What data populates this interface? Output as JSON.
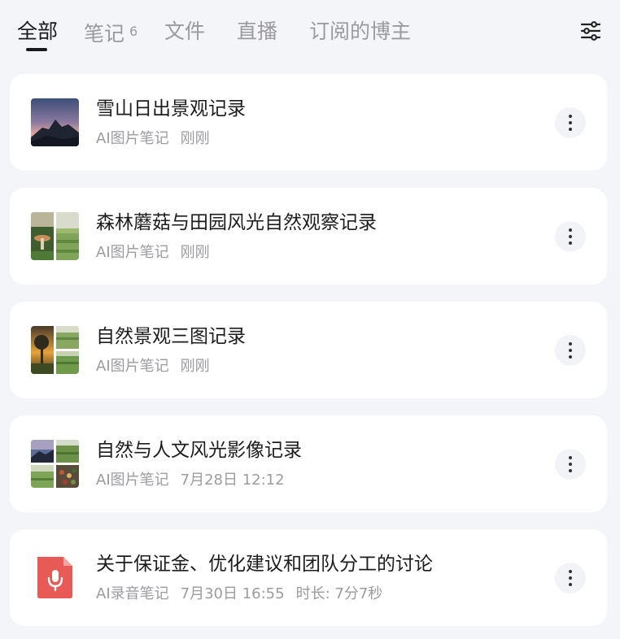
{
  "tabs": [
    {
      "label": "全部",
      "active": true
    },
    {
      "label": "笔记",
      "badge": "6"
    },
    {
      "label": "文件"
    },
    {
      "label": "直播"
    },
    {
      "label": "订阅的博主"
    }
  ],
  "notes": [
    {
      "title": "雪山日出景观记录",
      "type": "AI图片笔记",
      "time": "刚刚",
      "thumb": "mountain-sunrise-photo"
    },
    {
      "title": "森林蘑菇与田园风光自然观察记录",
      "type": "AI图片笔记",
      "time": "刚刚",
      "thumb": "two-photo-collage"
    },
    {
      "title": "自然景观三图记录",
      "type": "AI图片笔记",
      "time": "刚刚",
      "thumb": "three-photo-collage"
    },
    {
      "title": "自然与人文风光影像记录",
      "type": "AI图片笔记",
      "time": "7月28日 12:12",
      "thumb": "four-photo-collage"
    },
    {
      "title": "关于保证金、优化建议和团队分工的讨论",
      "type": "AI录音笔记",
      "time": "7月30日 16:55",
      "duration": "时长: 7分7秒",
      "thumb": "audio-file-icon"
    }
  ],
  "colors": {
    "background": "#f4f5f9",
    "card": "#ffffff",
    "audio_icon": "#e85a55"
  }
}
